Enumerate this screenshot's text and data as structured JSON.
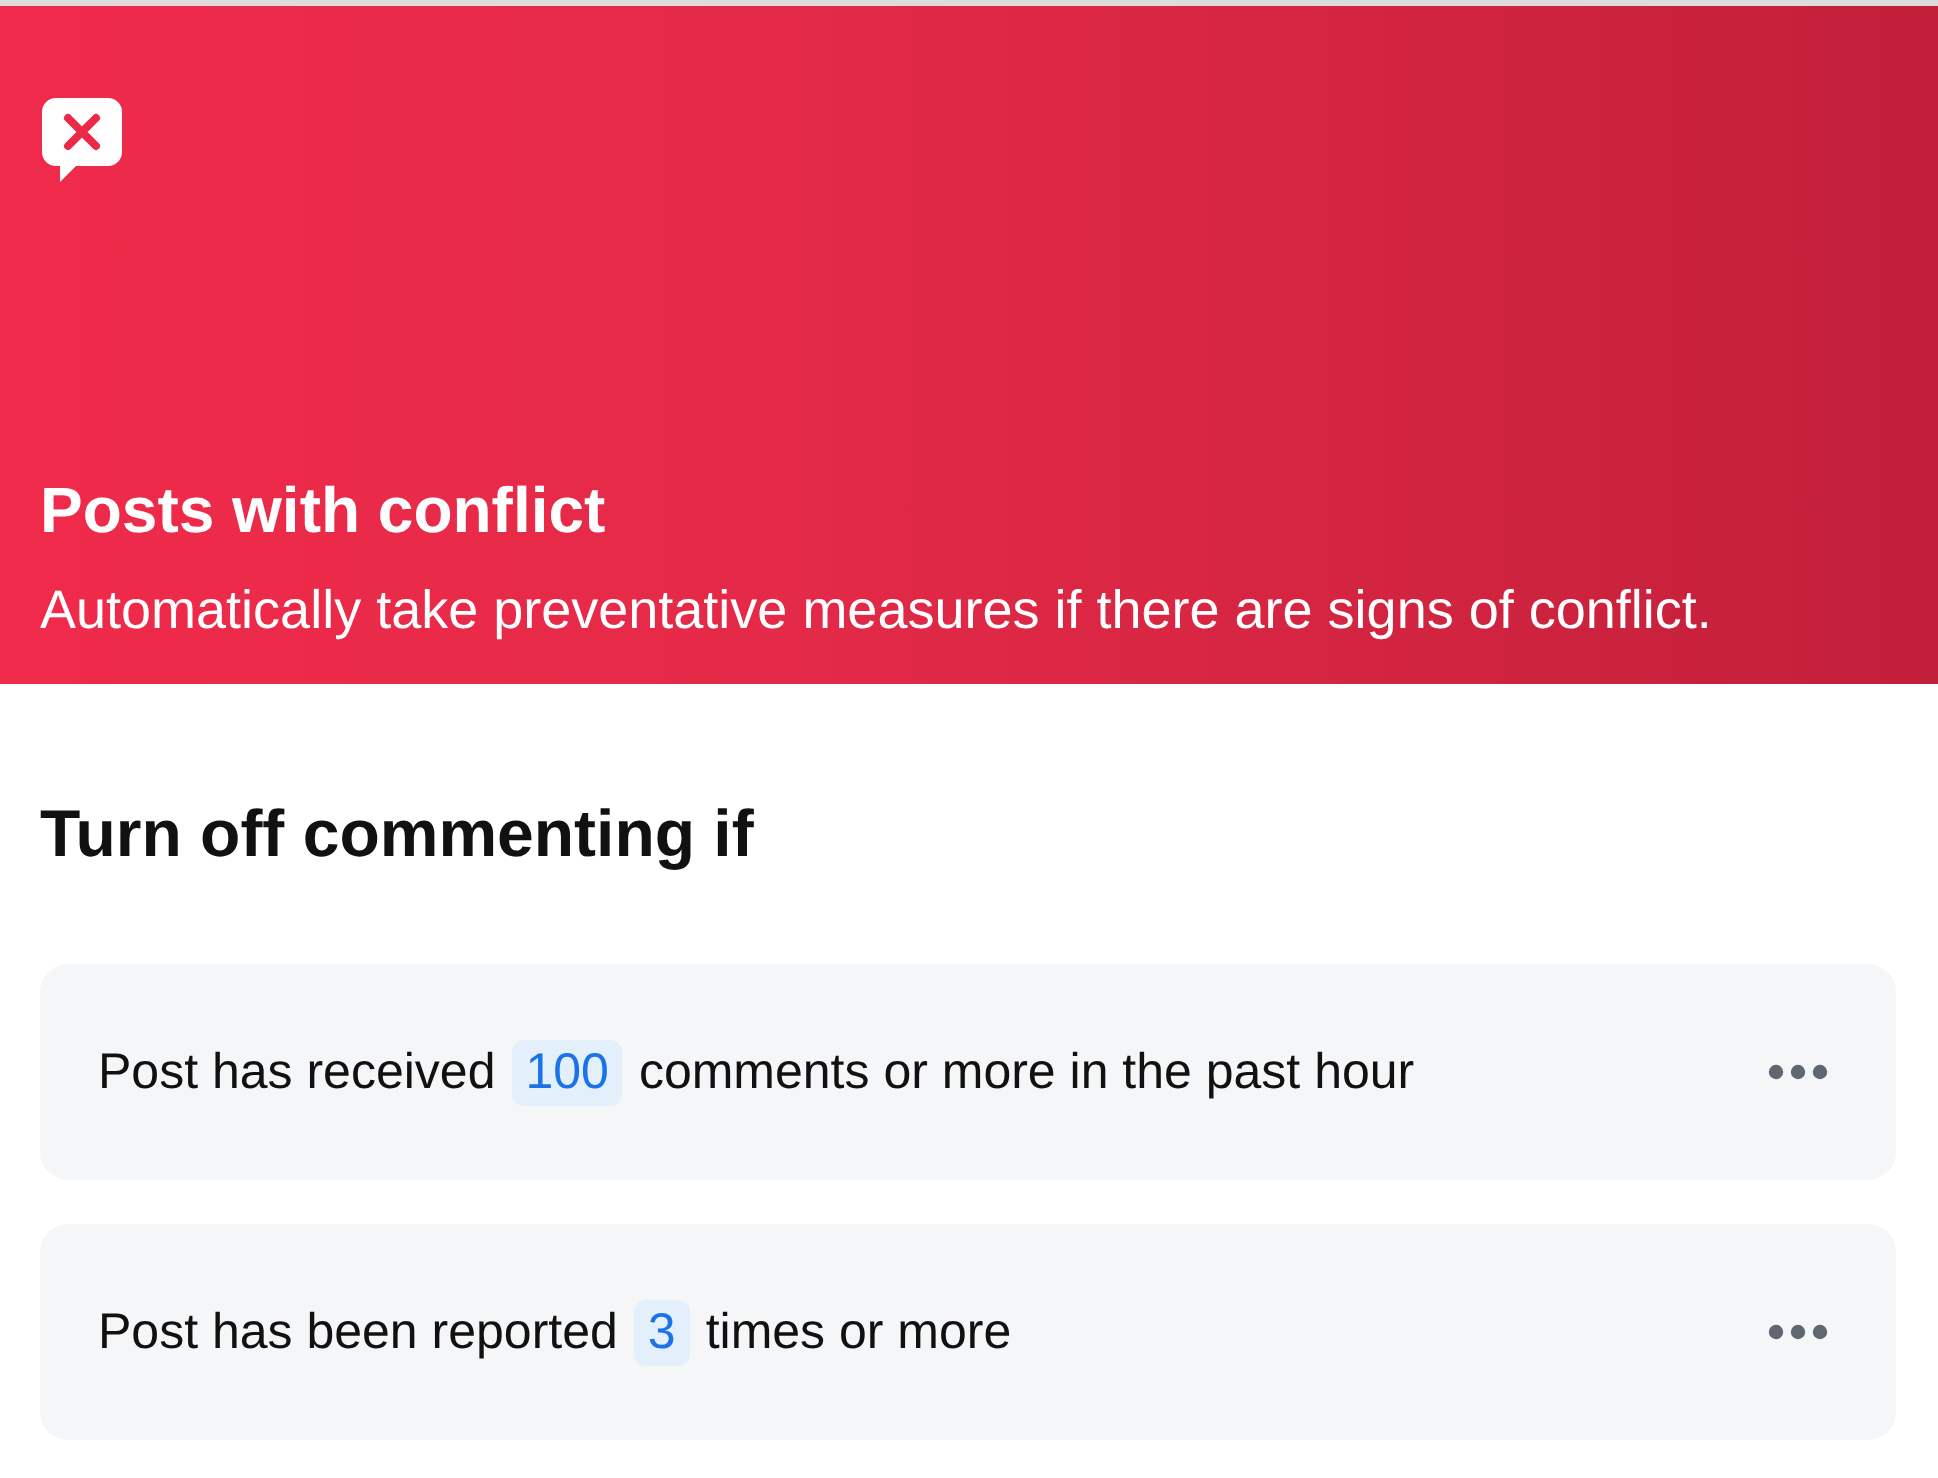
{
  "header": {
    "title": "Posts with conflict",
    "description": "Automatically take preventative measures if there are signs of conflict."
  },
  "section": {
    "title": "Turn off commenting if"
  },
  "rules": [
    {
      "before": "Post has received",
      "value": "100",
      "after": "comments or more in the past hour"
    },
    {
      "before": "Post has been reported",
      "value": "3",
      "after": "times or more"
    }
  ]
}
